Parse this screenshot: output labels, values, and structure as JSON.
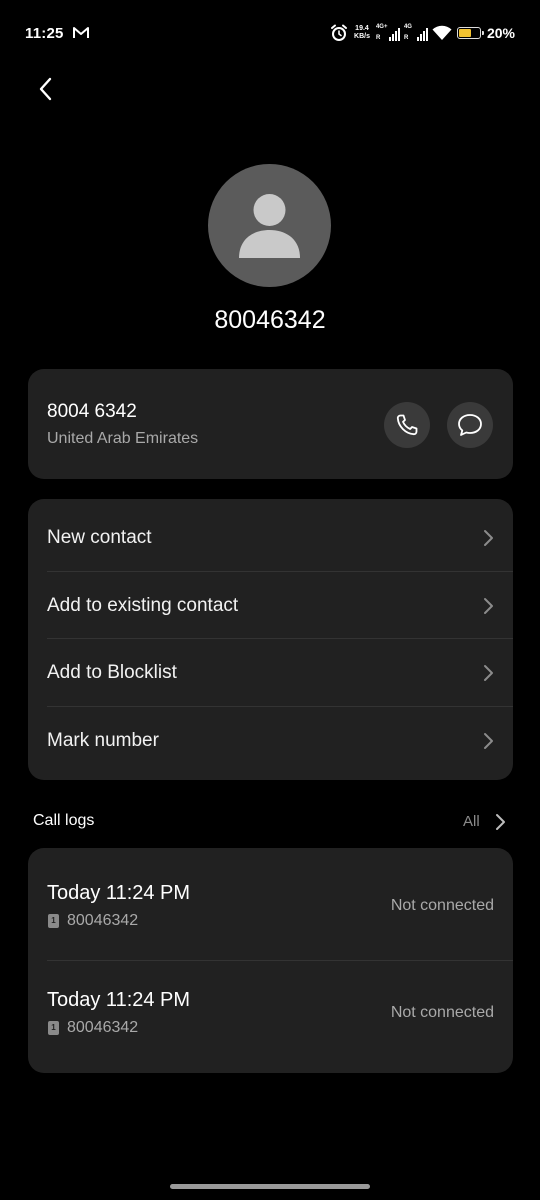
{
  "status_bar": {
    "time": "11:25",
    "net_speed_value": "19.4",
    "net_speed_unit": "KB/s",
    "sim1_label": "4G+",
    "sim2_label": "4G",
    "roaming_label": "R",
    "battery_percent": "20%",
    "battery_level": 0.2,
    "battery_color": "#f2c230"
  },
  "header": {
    "title": "80046342"
  },
  "phone_card": {
    "number": "8004 6342",
    "country": "United Arab Emirates"
  },
  "actions": [
    {
      "label": "New contact"
    },
    {
      "label": "Add to existing contact"
    },
    {
      "label": "Add to Blocklist"
    },
    {
      "label": "Mark number"
    }
  ],
  "call_logs": {
    "title": "Call logs",
    "all_label": "All",
    "entries": [
      {
        "time": "Today 11:24 PM",
        "sim": "1",
        "number": "80046342",
        "status": "Not connected"
      },
      {
        "time": "Today 11:24 PM",
        "sim": "1",
        "number": "80046342",
        "status": "Not connected"
      }
    ]
  },
  "colors": {
    "background": "#000000",
    "card": "#212121",
    "secondary_text": "#a9a9a9",
    "avatar_bg": "#5b5b5b"
  }
}
